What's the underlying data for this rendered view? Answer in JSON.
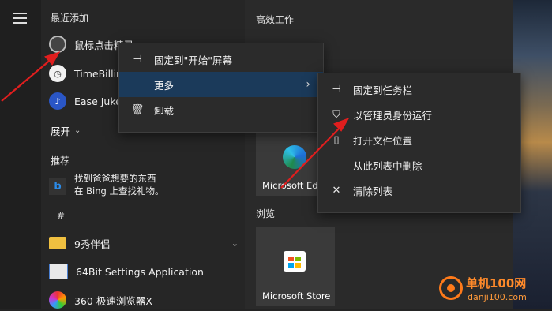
{
  "start": {
    "recent_title": "最近添加",
    "expand_label": "展开",
    "recommended_title": "推荐",
    "productivity_title": "高效工作",
    "browse_title": "浏览",
    "recent_apps": [
      {
        "label": "鼠标点击精灵",
        "icon": "cursor-target-icon"
      },
      {
        "label": "TimeBilling",
        "icon": "clock-icon"
      },
      {
        "label": "Ease Juke",
        "icon": "music-disc-icon"
      }
    ],
    "recommended": {
      "line1": "找到爸爸想要的东西",
      "line2": "在 Bing 上查找礼物。"
    },
    "letter_header": "#",
    "list_apps": [
      {
        "label": "9秀伴侣",
        "icon": "folder-icon"
      },
      {
        "label": "64Bit Settings Application",
        "icon": "settings-app-icon"
      },
      {
        "label": "360 极速浏览器X",
        "icon": "browser-360-icon"
      }
    ],
    "tiles": {
      "edge": "Microsoft Edge",
      "store": "Microsoft Store"
    }
  },
  "context_menu": {
    "items": [
      {
        "label": "固定到\"开始\"屏幕",
        "icon": "pin-icon"
      },
      {
        "label": "更多",
        "icon": ""
      },
      {
        "label": "卸载",
        "icon": "trash-icon"
      }
    ]
  },
  "submenu": {
    "items": [
      {
        "label": "固定到任务栏",
        "icon": "pin-icon"
      },
      {
        "label": "以管理员身份运行",
        "icon": "shield-icon"
      },
      {
        "label": "打开文件位置",
        "icon": "file-icon"
      },
      {
        "label": "从此列表中删除",
        "icon": ""
      },
      {
        "label": "清除列表",
        "icon": "close-icon"
      }
    ]
  },
  "watermark": {
    "name": "单机100网",
    "url": "danji100.com"
  },
  "colors": {
    "accent": "#1b3a5a",
    "arrow": "#e01e1e",
    "menu_bg": "#2b2b2b"
  }
}
